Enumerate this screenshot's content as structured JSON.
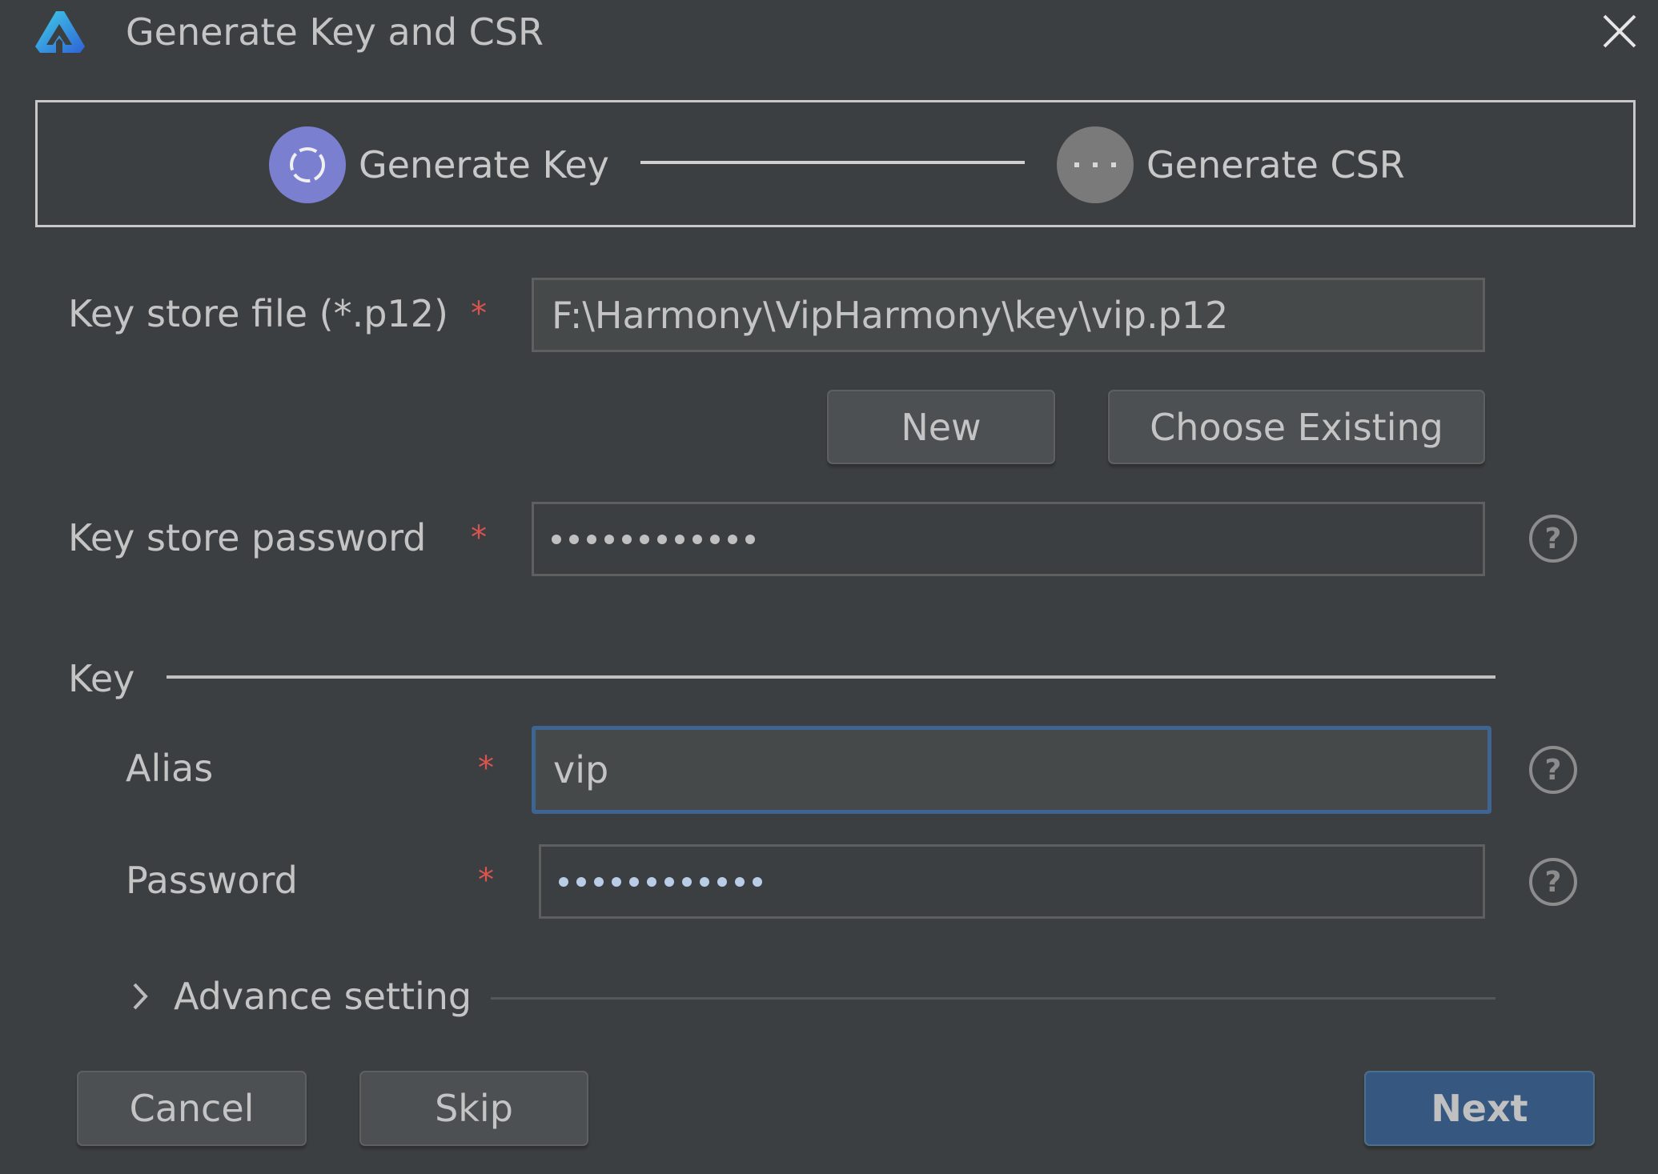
{
  "dialog": {
    "title": "Generate Key and CSR",
    "logo_icon": "harmony-logo-icon",
    "close_icon": "close-icon"
  },
  "steps": [
    {
      "label": "Generate Key",
      "state": "active",
      "icon": "loading-icon",
      "color": "#7b7fd0"
    },
    {
      "label": "Generate CSR",
      "state": "pending",
      "icon": "more-dots-icon",
      "color": "#7a7a7a"
    }
  ],
  "form": {
    "keystore_file": {
      "label": "Key store file (*.p12)",
      "required": "*",
      "value": "F:\\Harmony\\VipHarmony\\key\\vip.p12"
    },
    "new_button": "New",
    "choose_existing_button": "Choose Existing",
    "keystore_password": {
      "label": "Key store password",
      "required": "*",
      "masked_length": 12
    },
    "key_section": {
      "label": "Key",
      "alias": {
        "label": "Alias",
        "required": "*",
        "value": "vip"
      },
      "password": {
        "label": "Password",
        "required": "*",
        "masked_length": 12
      }
    },
    "advance_setting": {
      "label": "Advance setting",
      "expanded": false
    }
  },
  "footer": {
    "cancel": "Cancel",
    "skip": "Skip",
    "next": "Next"
  },
  "colors": {
    "background": "#3c3f41",
    "accent": "#365880",
    "focus": "#3e6591",
    "required": "#d9534f"
  }
}
